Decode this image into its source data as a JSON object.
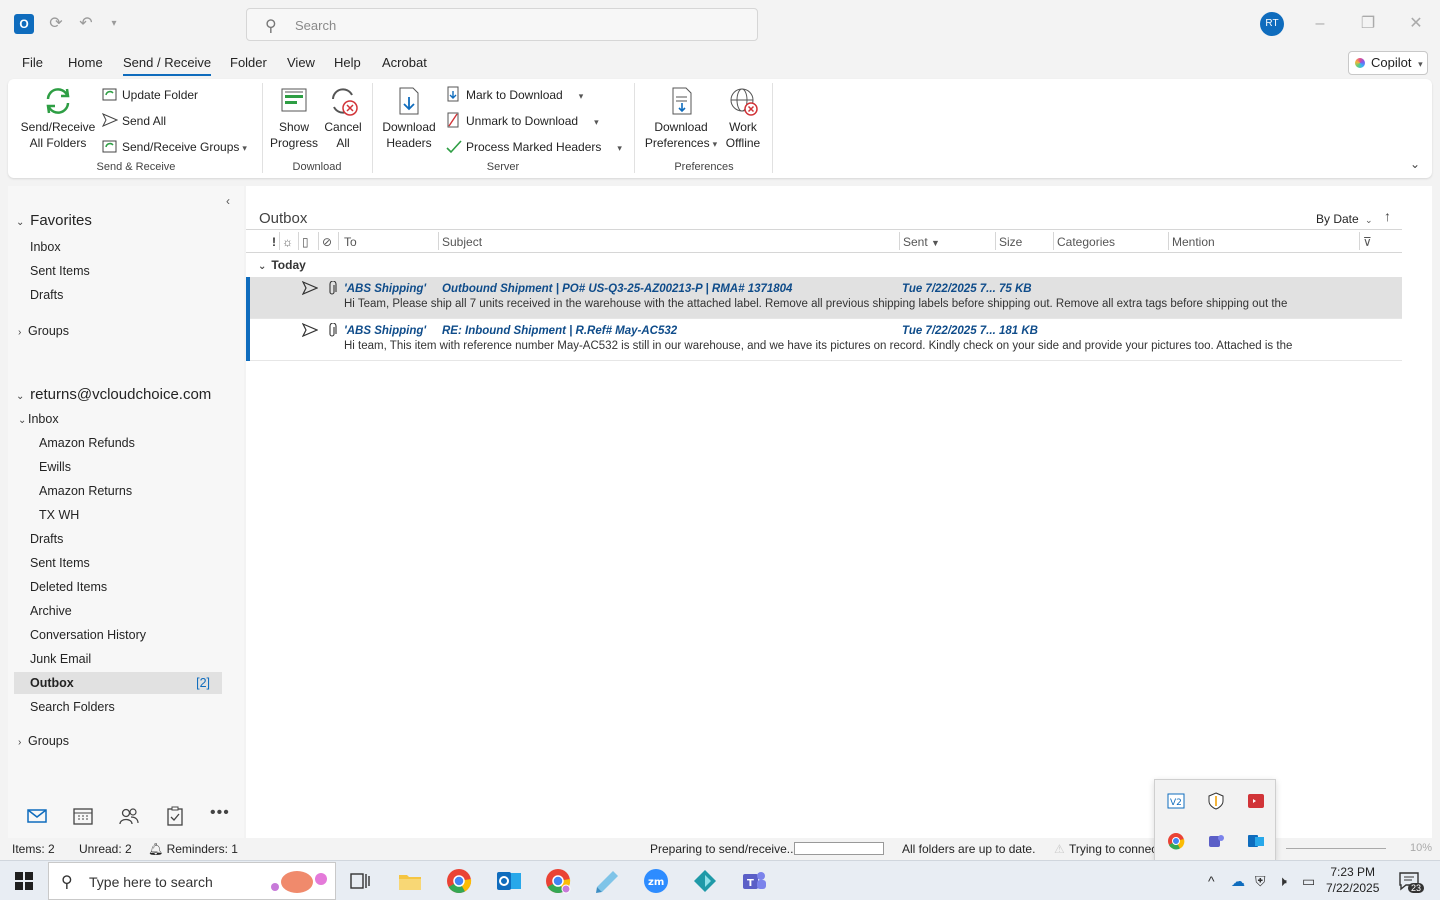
{
  "titlebar": {
    "search_placeholder": "Search",
    "avatar_initials": "RT"
  },
  "menu": {
    "tabs": [
      "File",
      "Home",
      "Send / Receive",
      "Folder",
      "View",
      "Help",
      "Acrobat"
    ],
    "copilot_label": "Copilot"
  },
  "ribbon": {
    "send_receive_all": [
      "Send/Receive",
      "All Folders"
    ],
    "update_folder": "Update Folder",
    "send_all": "Send All",
    "send_receive_groups": "Send/Receive Groups",
    "group_send_receive": "Send & Receive",
    "show_progress": [
      "Show",
      "Progress"
    ],
    "cancel_all": [
      "Cancel",
      "All"
    ],
    "group_download": "Download",
    "download_headers": [
      "Download",
      "Headers"
    ],
    "mark_to_download": "Mark to Download",
    "unmark_to_download": "Unmark to Download",
    "process_marked_headers": "Process Marked Headers",
    "group_server": "Server",
    "download_preferences": [
      "Download",
      "Preferences"
    ],
    "work_offline": [
      "Work",
      "Offline"
    ],
    "group_preferences": "Preferences"
  },
  "nav": {
    "favorites": "Favorites",
    "favorites_items": [
      "Inbox",
      "Sent Items",
      "Drafts"
    ],
    "groups": "Groups",
    "account": "returns@vcloudchoice.com",
    "inbox": "Inbox",
    "inbox_sub": [
      "Amazon Refunds",
      "Ewills",
      "Amazon Returns",
      "TX WH"
    ],
    "folders": [
      "Drafts",
      "Sent Items",
      "Deleted Items",
      "Archive",
      "Conversation History",
      "Junk Email"
    ],
    "outbox": "Outbox",
    "outbox_count": "[2]",
    "search_folders": "Search Folders",
    "groups2": "Groups"
  },
  "list": {
    "folder": "Outbox",
    "sort_label": "By Date",
    "columns": {
      "importance": "!",
      "to": "To",
      "subject": "Subject",
      "sent": "Sent",
      "size": "Size",
      "categories": "Categories",
      "mention": "Mention"
    },
    "group_today": "Today",
    "messages": [
      {
        "to": "'ABS Shipping'",
        "subject": "Outbound Shipment | PO# US-Q3-25-AZ00213-P | RMA# 1371804",
        "sent": "Tue 7/22/2025 7...",
        "size": "75 KB",
        "preview": "Hi Team,  Please ship all 7 units received in the warehouse with the attached label.  Remove all previous shipping labels before shipping out.  Remove all extra tags before shipping out the"
      },
      {
        "to": "'ABS Shipping'",
        "subject": "RE: Inbound Shipment | R.Ref# May-AC532",
        "sent": "Tue 7/22/2025 7...",
        "size": "181 KB",
        "preview": "Hi team,  This item with reference number May-AC532 is still in our warehouse, and we have its pictures on record. Kindly check on your side and provide your pictures too. Attached is the"
      }
    ]
  },
  "status": {
    "items": "Items: 2",
    "unread": "Unread: 2",
    "reminders": "Reminders: 1",
    "preparing": "Preparing to send/receive...",
    "uptodate": "All folders are up to date.",
    "trying": "Trying to connec",
    "zoom": "10%"
  },
  "taskbar": {
    "search_placeholder": "Type here to search",
    "time": "7:23 PM",
    "date": "7/22/2025",
    "notif_count": "23"
  },
  "colors": {
    "accent": "#0f6cbd",
    "unread_text": "#0f4c8a"
  }
}
